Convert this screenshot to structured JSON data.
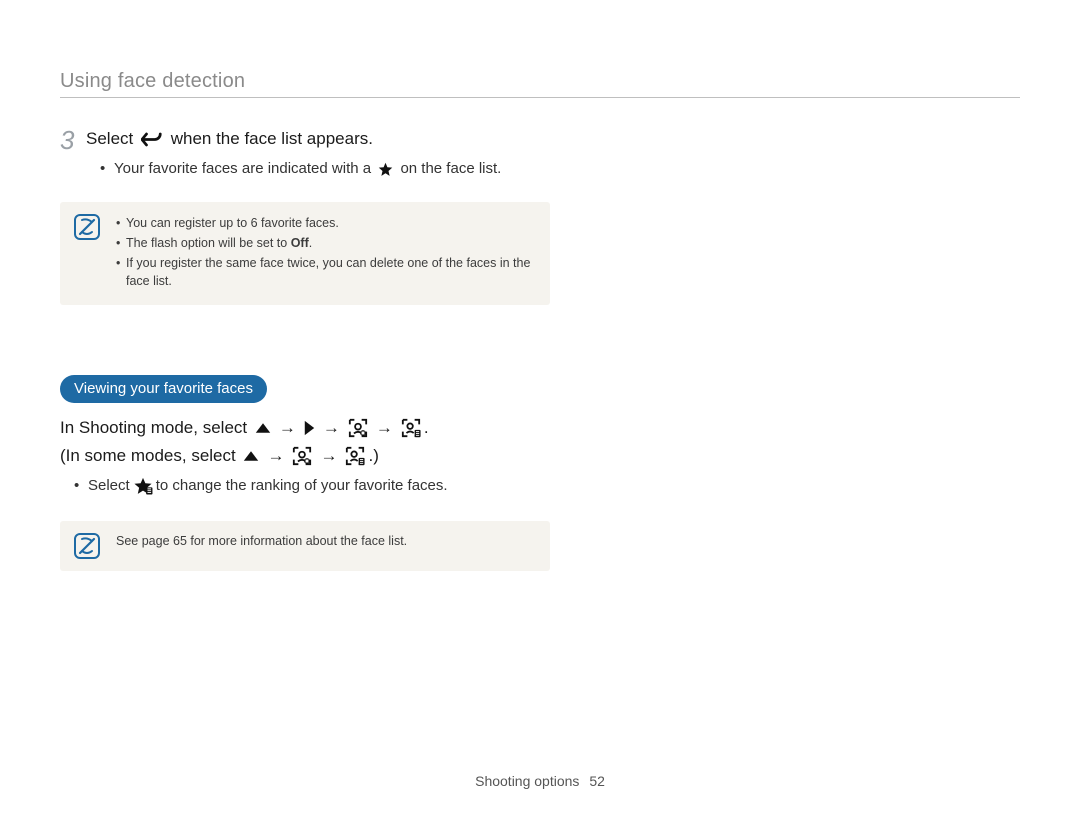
{
  "header": {
    "title": "Using face detection"
  },
  "step3": {
    "num": "3",
    "pre": "Select ",
    "post": " when the face list appears.",
    "bullet_pre": "Your favorite faces are indicated with a ",
    "bullet_post": " on the face list."
  },
  "note1": {
    "items": [
      "You can register up to 6 favorite faces.",
      "The flash option will be set to ",
      "If you register the same face twice, you can delete one of the faces in the face list."
    ],
    "off": "Off"
  },
  "section": {
    "title": "Viewing your favorite faces"
  },
  "path1": {
    "pre": "In Shooting mode, select "
  },
  "path2": {
    "pre": "(In some modes, select ",
    "post": ".)"
  },
  "bullet2": {
    "pre": "Select ",
    "post": " to change the ranking of your favorite faces."
  },
  "note2": {
    "text": "See page 65 for more information about the face list."
  },
  "footer": {
    "section": "Shooting options",
    "page": "52"
  }
}
